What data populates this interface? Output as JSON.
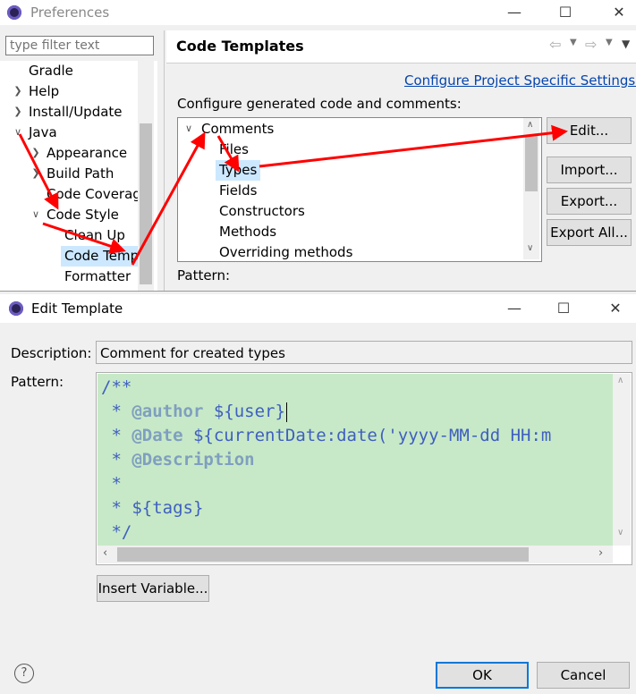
{
  "prefs": {
    "title": "Preferences",
    "filter_placeholder": "type filter text",
    "tree": [
      {
        "label": "Gradle"
      },
      {
        "label": "Help"
      },
      {
        "label": "Install/Update"
      },
      {
        "label": "Java"
      },
      {
        "label": "Appearance"
      },
      {
        "label": "Build Path"
      },
      {
        "label": "Code Coverag"
      },
      {
        "label": "Code Style"
      },
      {
        "label": "Clean Up"
      },
      {
        "label": "Code Temp"
      },
      {
        "label": "Formatter"
      }
    ],
    "page_title": "Code Templates",
    "configure_link": "Configure Project Specific Settings...",
    "config_label": "Configure generated code and comments:",
    "templates": [
      {
        "label": "Comments"
      },
      {
        "label": "Files"
      },
      {
        "label": "Types"
      },
      {
        "label": "Fields"
      },
      {
        "label": "Constructors"
      },
      {
        "label": "Methods"
      },
      {
        "label": "Overriding methods"
      }
    ],
    "pattern_label": "Pattern:",
    "buttons": {
      "edit": "Edit...",
      "import": "Import...",
      "export": "Export...",
      "export_all": "Export All..."
    }
  },
  "edit": {
    "title": "Edit Template",
    "description_label": "Description:",
    "description_value": "Comment for created types",
    "pattern_label": "Pattern:",
    "insert_variable": "Insert Variable...",
    "ok": "OK",
    "cancel": "Cancel",
    "code": {
      "l1": "/**",
      "l2_pre": " * ",
      "l2_kw": "@author",
      "l2_var": " ${user}",
      "l3_pre": " * ",
      "l3_kw": "@Date",
      "l3_var": " ${currentDate:date('yyyy-MM-dd HH:m",
      "l4_pre": " * ",
      "l4_kw": "@Description",
      "l5": " *",
      "l6_pre": " * ",
      "l6_var": "${tags}",
      "l7": " */"
    },
    "editor_bg": "#c7e9c7"
  },
  "colors": {
    "link": "#0645ad",
    "arrow": "#ff0000",
    "selection": "#cce8ff"
  }
}
